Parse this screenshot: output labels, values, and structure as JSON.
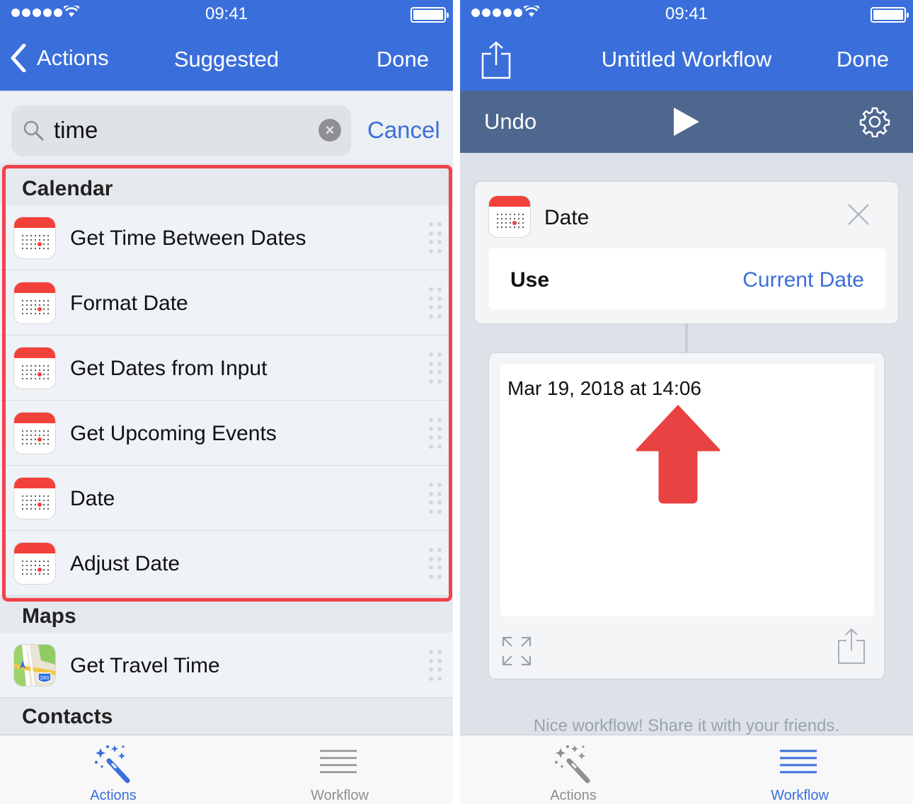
{
  "status": {
    "time": "09:41"
  },
  "left": {
    "nav": {
      "back_label": "Actions",
      "title": "Suggested",
      "done_label": "Done"
    },
    "search": {
      "query": "time",
      "cancel_label": "Cancel"
    },
    "sections": [
      {
        "header": "Calendar",
        "items": [
          "Get Time Between Dates",
          "Format Date",
          "Get Dates from Input",
          "Get Upcoming Events",
          "Date",
          "Adjust Date"
        ]
      },
      {
        "header": "Maps",
        "items": [
          "Get Travel Time"
        ]
      },
      {
        "header": "Contacts"
      }
    ],
    "maps_badge": "280",
    "tabs": [
      {
        "label": "Actions",
        "active": true
      },
      {
        "label": "Workflow",
        "active": false
      }
    ]
  },
  "right": {
    "nav": {
      "title": "Untitled Workflow",
      "done_label": "Done"
    },
    "toolbar": {
      "undo_label": "Undo"
    },
    "action_card": {
      "title": "Date",
      "param_label": "Use",
      "param_value": "Current Date"
    },
    "result": {
      "text": "Mar 19, 2018 at 14:06"
    },
    "footer_message": "Nice workflow! Share it with your friends.",
    "tabs": [
      {
        "label": "Actions",
        "active": false
      },
      {
        "label": "Workflow",
        "active": true
      }
    ]
  },
  "colors": {
    "accent": "#3a6fdb",
    "toolbar": "#4e678f",
    "highlight": "#f0434b",
    "calendar_red": "#f2413a",
    "inactive_tab": "#8e8e93"
  },
  "icons": [
    "search-icon",
    "clear-icon",
    "calendar-icon",
    "maps-icon",
    "drag-handle-icon",
    "magic-wand-icon",
    "list-icon",
    "share-icon",
    "play-icon",
    "gear-icon",
    "close-icon",
    "expand-icon",
    "up-arrow-icon"
  ]
}
